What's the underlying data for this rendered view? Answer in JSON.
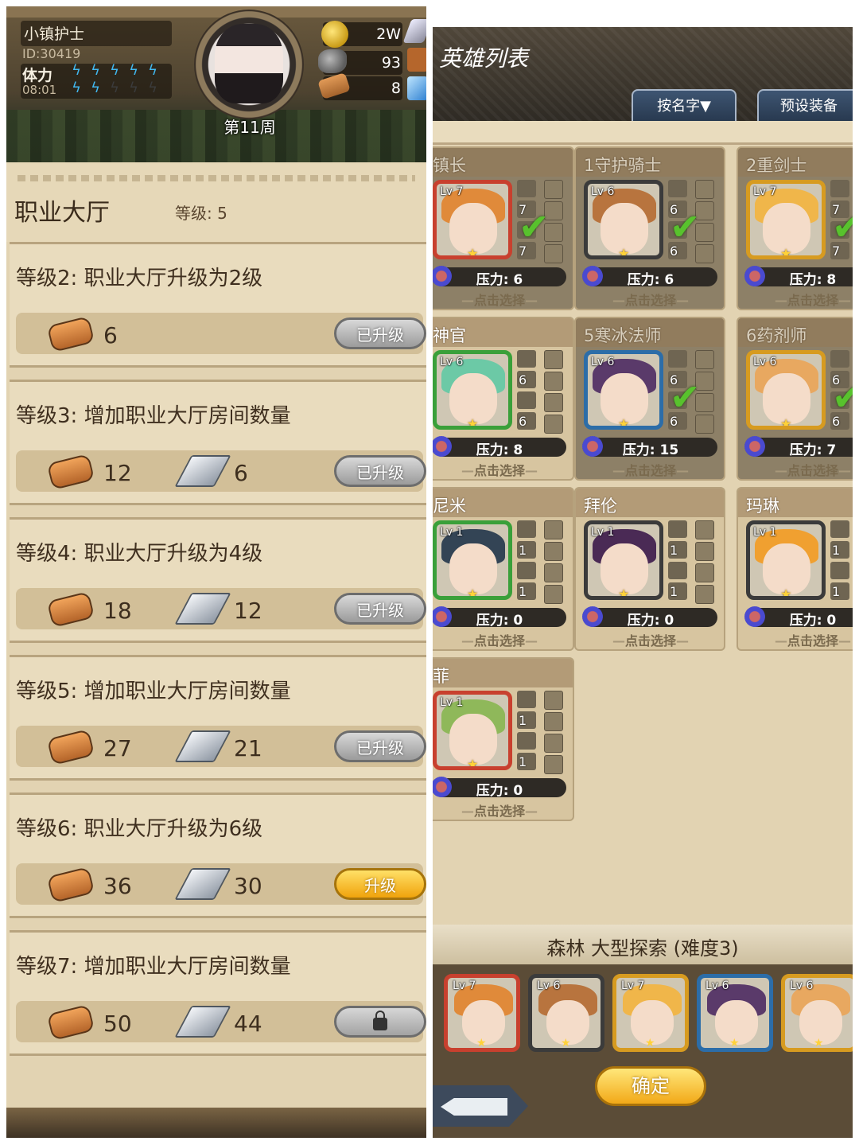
{
  "left": {
    "player": {
      "name": "小镇护士",
      "id": "ID:30419",
      "stamina_label": "体力",
      "stamina_timer": "08:01",
      "stamina_full": 5,
      "stamina_empty": 3
    },
    "resources": {
      "gold": "2W",
      "ore": "93",
      "wood": "8"
    },
    "week": "第11周",
    "hall": {
      "title": "职业大厅",
      "level": "等级: 5"
    },
    "levels": [
      {
        "caption": "等级2: 职业大厅升级为2级",
        "wood": "6",
        "steel": "",
        "button": "已升级",
        "state": "done"
      },
      {
        "caption": "等级3: 增加职业大厅房间数量",
        "wood": "12",
        "steel": "6",
        "button": "已升级",
        "state": "done"
      },
      {
        "caption": "等级4: 职业大厅升级为4级",
        "wood": "18",
        "steel": "12",
        "button": "已升级",
        "state": "done"
      },
      {
        "caption": "等级5: 增加职业大厅房间数量",
        "wood": "27",
        "steel": "21",
        "button": "已升级",
        "state": "done"
      },
      {
        "caption": "等级6: 职业大厅升级为6级",
        "wood": "36",
        "steel": "30",
        "button": "升级",
        "state": "up"
      },
      {
        "caption": "等级7: 增加职业大厅房间数量",
        "wood": "50",
        "steel": "44",
        "button": "",
        "state": "lock"
      }
    ]
  },
  "right": {
    "title": "英雄列表",
    "tabs": {
      "sort": "按名字▼",
      "preset": "预设装备"
    },
    "pick_label": "点击选择",
    "heroes": [
      {
        "name": "镇长",
        "lv": "Lv 7",
        "e1": "7",
        "e2": "7",
        "pressure": "压力: 6",
        "selected": true,
        "color": "#c8402e",
        "hair": "#e08a3a"
      },
      {
        "name": "1守护骑士",
        "lv": "Lv 6",
        "e1": "6",
        "e2": "6",
        "pressure": "压力: 6",
        "selected": true,
        "color": "#3b3b3b",
        "hair": "#b8743e"
      },
      {
        "name": "2重剑士",
        "lv": "Lv 7",
        "e1": "7",
        "e2": "7",
        "pressure": "压力: 8",
        "selected": true,
        "color": "#d79b20",
        "hair": "#f0b64a"
      },
      {
        "name": "神官",
        "lv": "Lv 6",
        "e1": "6",
        "e2": "6",
        "pressure": "压力: 8",
        "selected": false,
        "color": "#3aa03a",
        "hair": "#6cc9a6"
      },
      {
        "name": "5寒冰法师",
        "lv": "Lv 6",
        "e1": "6",
        "e2": "6",
        "pressure": "压力: 15",
        "selected": true,
        "color": "#2c6da8",
        "hair": "#5a3a6a"
      },
      {
        "name": "6药剂师",
        "lv": "Lv 6",
        "e1": "6",
        "e2": "6",
        "pressure": "压力: 7",
        "selected": true,
        "color": "#d79b20",
        "hair": "#e8a860"
      },
      {
        "name": "尼米",
        "lv": "Lv 1",
        "e1": "1",
        "e2": "1",
        "pressure": "压力: 0",
        "selected": false,
        "color": "#3aa03a",
        "hair": "#334455"
      },
      {
        "name": "拜伦",
        "lv": "Lv 1",
        "e1": "1",
        "e2": "1",
        "pressure": "压力: 0",
        "selected": false,
        "color": "#3b3b3b",
        "hair": "#4a2a55"
      },
      {
        "name": "玛琳",
        "lv": "Lv 1",
        "e1": "1",
        "e2": "1",
        "pressure": "压力: 0",
        "selected": false,
        "color": "#3b3b3b",
        "hair": "#f0a030"
      },
      {
        "name": "菲",
        "lv": "Lv 1",
        "e1": "1",
        "e2": "1",
        "pressure": "压力: 0",
        "selected": false,
        "color": "#c8402e",
        "hair": "#8fb85a"
      }
    ],
    "expedition": {
      "title": "森林 大型探索 (难度3)",
      "confirm": "确定",
      "team": [
        {
          "lv": "Lv 7",
          "color": "#c8402e",
          "hair": "#e08a3a"
        },
        {
          "lv": "Lv 6",
          "color": "#3b3b3b",
          "hair": "#b8743e"
        },
        {
          "lv": "Lv 7",
          "color": "#d79b20",
          "hair": "#f0b64a"
        },
        {
          "lv": "Lv 6",
          "color": "#2c6da8",
          "hair": "#5a3a6a"
        },
        {
          "lv": "Lv 6",
          "color": "#d79b20",
          "hair": "#e8a860"
        }
      ]
    }
  }
}
